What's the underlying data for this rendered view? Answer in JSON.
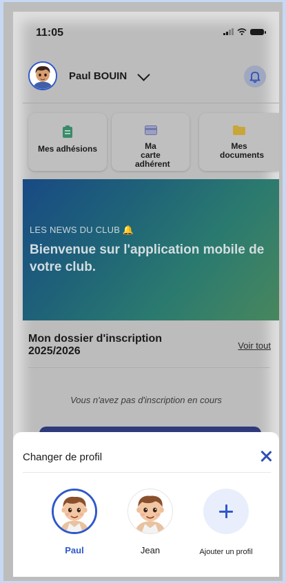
{
  "status": {
    "time": "11:05"
  },
  "header": {
    "user_name": "Paul BOUIN"
  },
  "quick_actions": [
    {
      "label": "Mes adhésions",
      "icon": "clipboard-icon"
    },
    {
      "label": "Ma carte adhérent",
      "icon": "card-icon"
    },
    {
      "label": "Mes documents",
      "icon": "folder-icon"
    }
  ],
  "news": {
    "kicker": "LES NEWS DU CLUB 🔔",
    "title": "Bienvenue sur l'application mobile de votre club."
  },
  "dossier": {
    "title": "Mon dossier d'inscription 2025/2026",
    "see_all": "Voir tout",
    "empty_message": "Vous n'avez pas d'inscription en cours"
  },
  "sheet": {
    "title": "Changer de profil",
    "profiles": [
      {
        "name": "Paul",
        "selected": true
      },
      {
        "name": "Jean",
        "selected": false
      }
    ],
    "add_label": "Ajouter un profil"
  },
  "colors": {
    "accent": "#2f58c9",
    "close": "#2f4fb8",
    "add_bg": "#e8eefb"
  }
}
